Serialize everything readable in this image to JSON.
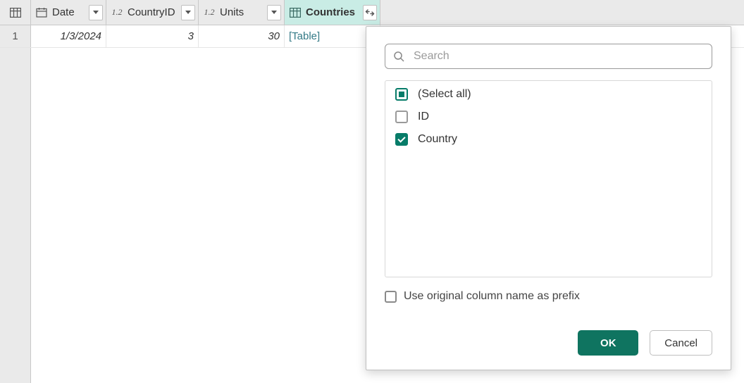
{
  "columns": {
    "date": {
      "label": "Date",
      "type": "date"
    },
    "countryId": {
      "label": "CountryID",
      "type": "number"
    },
    "units": {
      "label": "Units",
      "type": "number"
    },
    "countries": {
      "label": "Countries",
      "type": "table",
      "active": true
    }
  },
  "rows": [
    {
      "index": "1",
      "date": "1/3/2024",
      "countryId": "3",
      "units": "30",
      "countries": "[Table]"
    }
  ],
  "expand_popover": {
    "search_placeholder": "Search",
    "items": [
      {
        "label": "(Select all)",
        "state": "indeterminate"
      },
      {
        "label": "ID",
        "state": "unchecked"
      },
      {
        "label": "Country",
        "state": "checked"
      }
    ],
    "use_prefix_label": "Use original column name as prefix",
    "use_prefix_checked": false,
    "ok_label": "OK",
    "cancel_label": "Cancel"
  }
}
